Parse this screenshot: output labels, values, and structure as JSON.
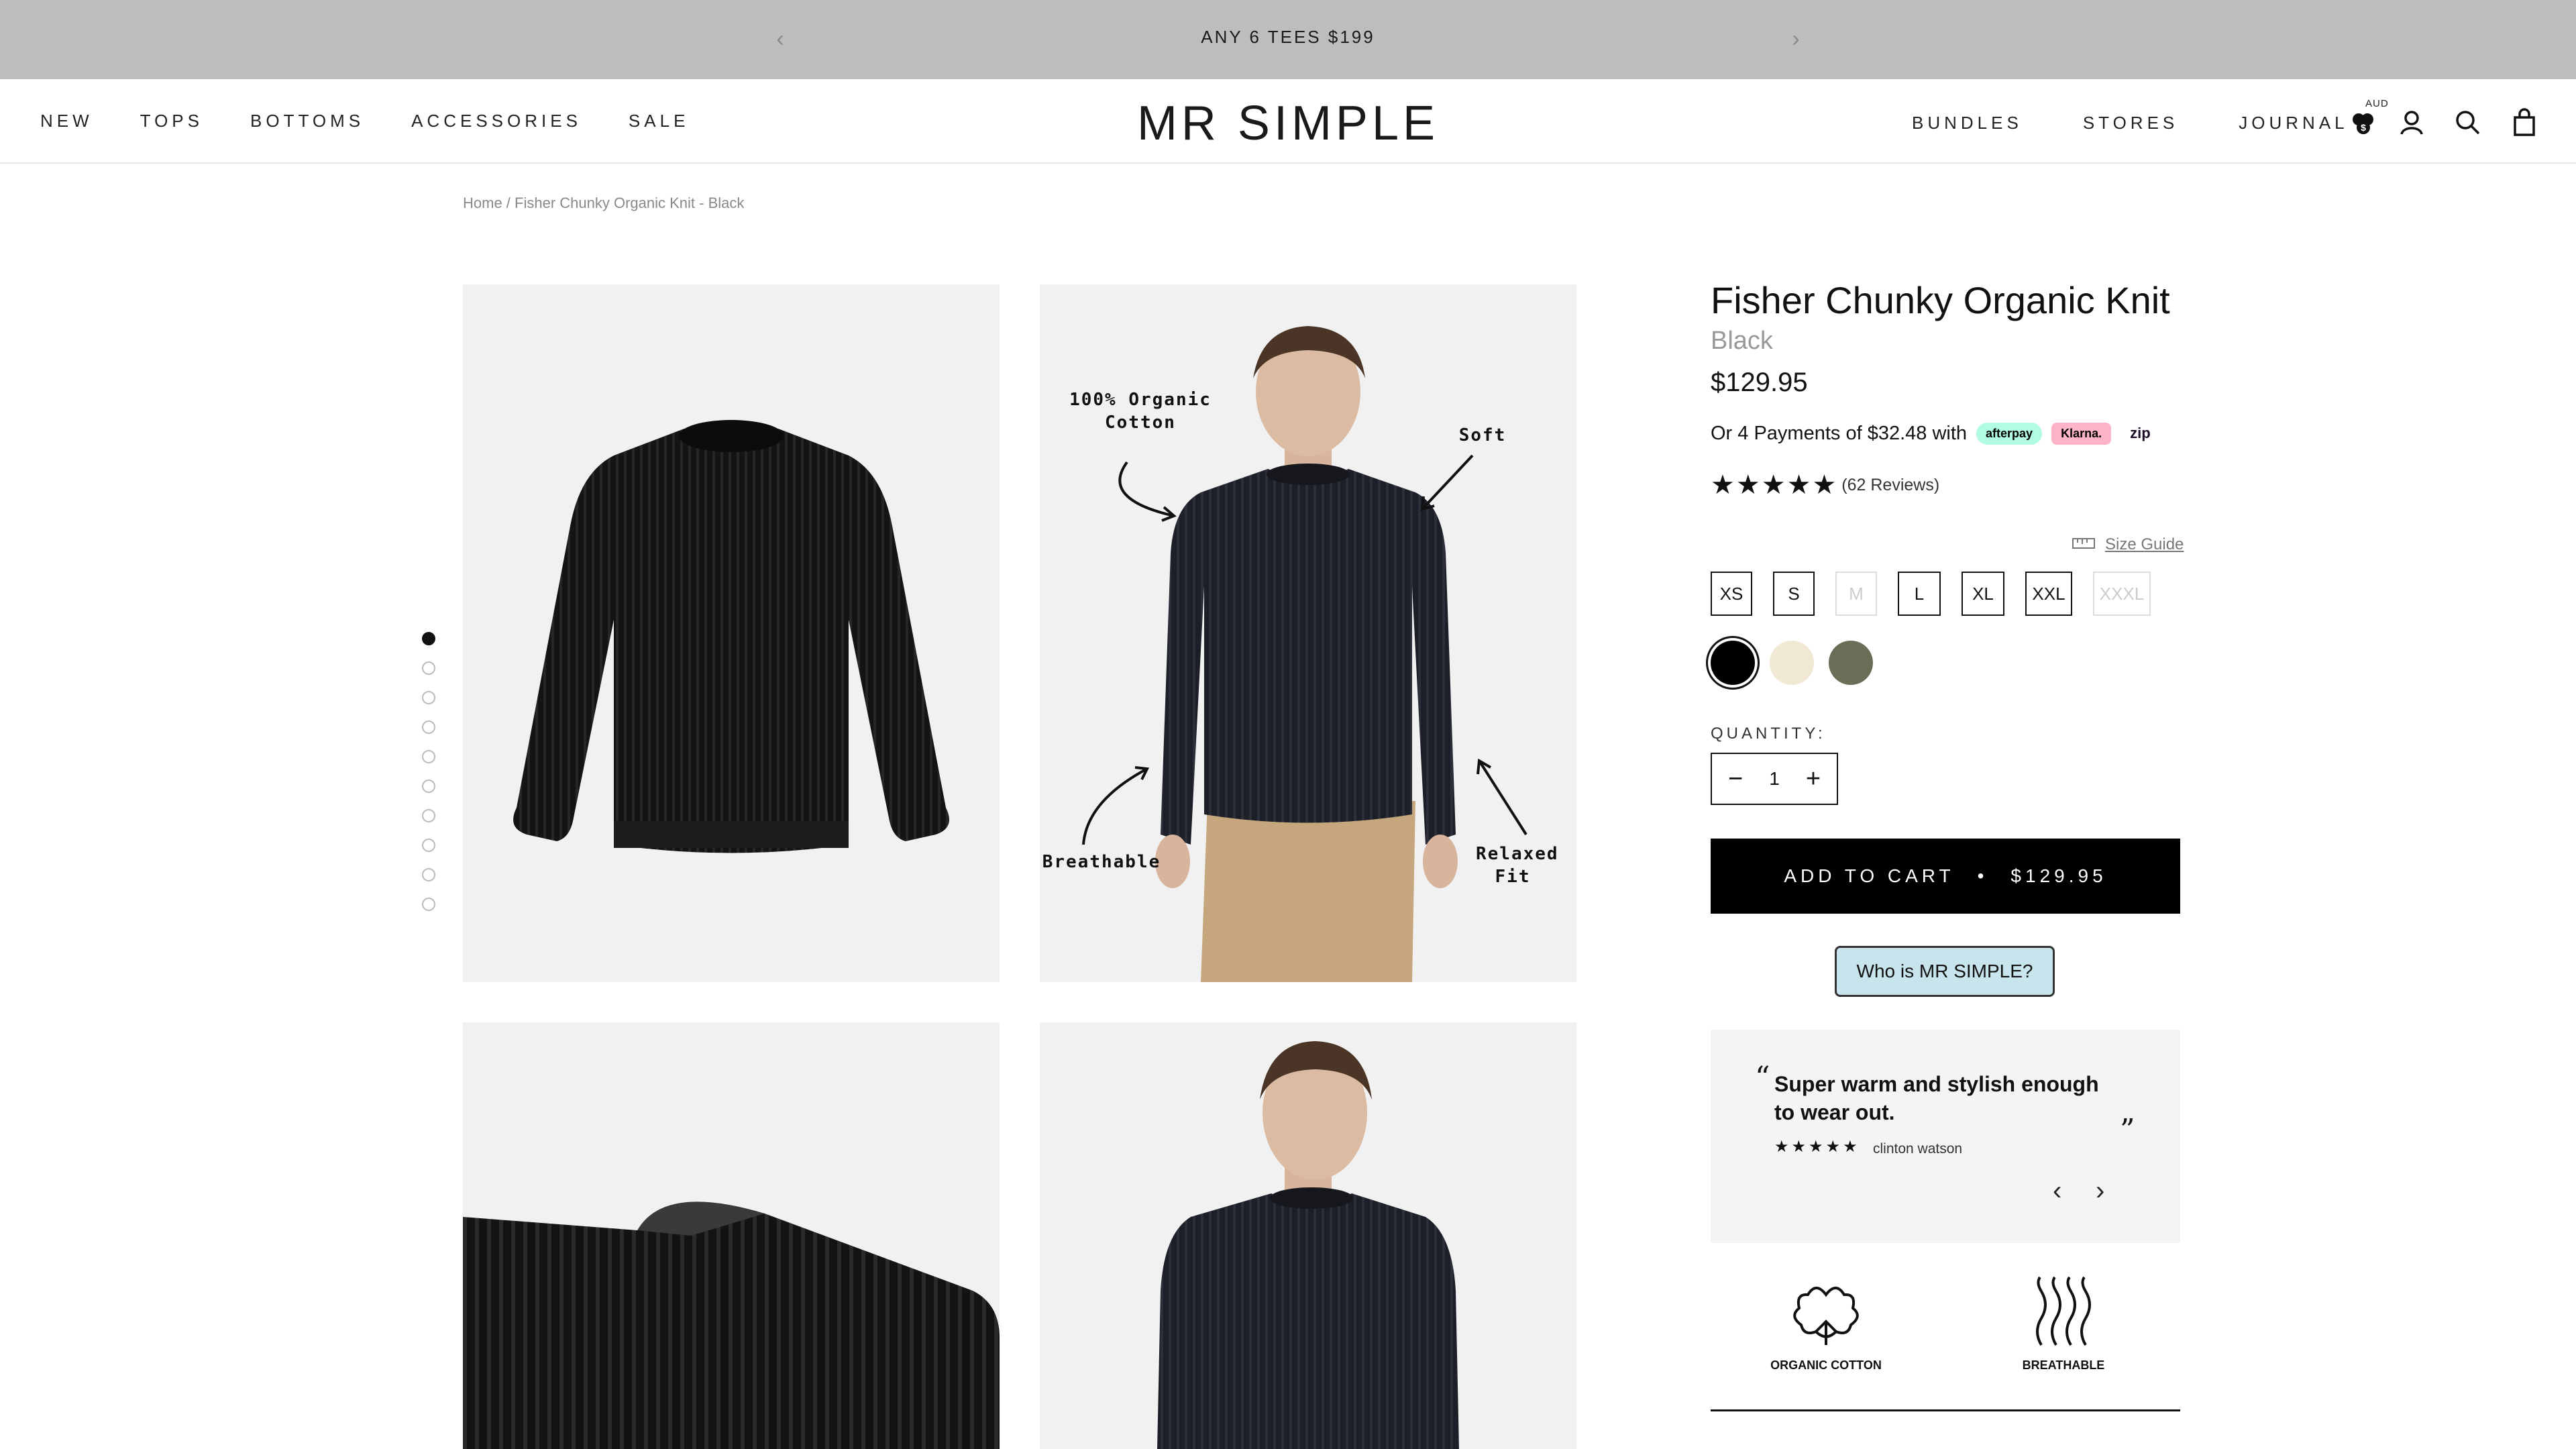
{
  "announcement": {
    "text": "ANY 6 TEES $199",
    "prev_icon": "chevron-left-icon",
    "next_icon": "chevron-right-icon"
  },
  "header": {
    "nav_left": [
      "NEW",
      "TOPS",
      "BOTTOMS",
      "ACCESSORIES",
      "SALE"
    ],
    "logo": "MR SIMPLE",
    "nav_right": [
      "BUNDLES",
      "STORES",
      "JOURNAL"
    ],
    "currency": "AUD",
    "icons": [
      "currency-icon",
      "account-icon",
      "search-icon",
      "cart-icon"
    ]
  },
  "breadcrumb": {
    "home": "Home",
    "separator": " / ",
    "current": "Fisher Chunky Organic Knit - Black"
  },
  "gallery": {
    "dots_total": 10,
    "dots_active_index": 0,
    "annotations": {
      "cotton": "100% Organic Cotton",
      "soft": "Soft",
      "breathable": "Breathable",
      "relaxed": "Relaxed Fit"
    }
  },
  "product": {
    "title": "Fisher Chunky Organic Knit",
    "color": "Black",
    "price": "$129.95",
    "payments_text": "Or 4 Payments of $32.48 with",
    "payment_providers": [
      "afterpay",
      "Klarna.",
      "zip"
    ],
    "rating": 4.5,
    "stars": "★★★★★",
    "reviews": "(62 Reviews)",
    "size_guide": "Size Guide",
    "sizes": [
      {
        "label": "XS",
        "available": true
      },
      {
        "label": "S",
        "available": true
      },
      {
        "label": "M",
        "available": false
      },
      {
        "label": "L",
        "available": true
      },
      {
        "label": "XL",
        "available": true
      },
      {
        "label": "XXL",
        "available": true
      },
      {
        "label": "XXXL",
        "available": false
      }
    ],
    "swatches": [
      {
        "name": "black",
        "color": "#000000",
        "selected": true
      },
      {
        "name": "cream",
        "color": "#f1e8d3",
        "selected": false
      },
      {
        "name": "olive",
        "color": "#6b6d57",
        "selected": false
      }
    ],
    "quantity_label": "QUANTITY:",
    "quantity": "1",
    "add_to_cart": "ADD TO CART",
    "bullet": "•",
    "cart_price": "$129.95",
    "who_button": "Who is MR SIMPLE?"
  },
  "review": {
    "quote": "Super warm and stylish enough to wear out.",
    "open_quote": "“",
    "close_quote": "”",
    "stars": "★★★★★",
    "author": "clinton watson"
  },
  "features": [
    {
      "icon": "cotton-flower-icon",
      "label": "ORGANIC COTTON"
    },
    {
      "icon": "breathable-waves-icon",
      "label": "BREATHABLE"
    }
  ]
}
